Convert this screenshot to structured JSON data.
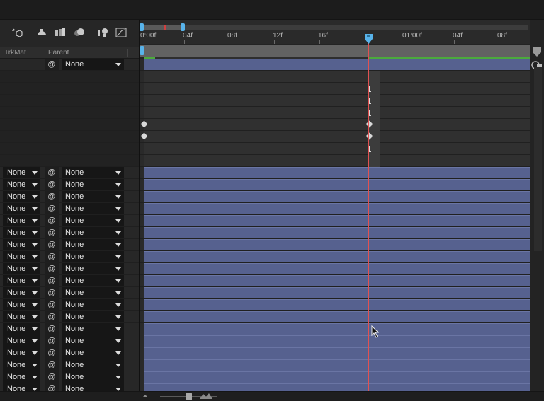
{
  "columns": {
    "trkmat": "TrkMat",
    "parent": "Parent"
  },
  "toolbar": {
    "icons": [
      "draft-3d-icon",
      "comp-flowchart-icon",
      "frame-blending-icon",
      "motion-blur-icon",
      "brainstorm-icon",
      "graph-editor-icon"
    ]
  },
  "top_layer": {
    "parent": "None"
  },
  "layers": [
    {
      "trkmat": "None",
      "parent": "None"
    },
    {
      "trkmat": "None",
      "parent": "None"
    },
    {
      "trkmat": "None",
      "parent": "None"
    },
    {
      "trkmat": "None",
      "parent": "None"
    },
    {
      "trkmat": "None",
      "parent": "None"
    },
    {
      "trkmat": "None",
      "parent": "None"
    },
    {
      "trkmat": "None",
      "parent": "None"
    },
    {
      "trkmat": "None",
      "parent": "None"
    },
    {
      "trkmat": "None",
      "parent": "None"
    },
    {
      "trkmat": "None",
      "parent": "None"
    },
    {
      "trkmat": "None",
      "parent": "None"
    },
    {
      "trkmat": "None",
      "parent": "None"
    },
    {
      "trkmat": "None",
      "parent": "None"
    },
    {
      "trkmat": "None",
      "parent": "None"
    },
    {
      "trkmat": "None",
      "parent": "None"
    },
    {
      "trkmat": "None",
      "parent": "None"
    },
    {
      "trkmat": "None",
      "parent": "None"
    },
    {
      "trkmat": "None",
      "parent": "None"
    },
    {
      "trkmat": "None",
      "parent": "None"
    }
  ],
  "ruler": {
    "ticks": [
      "0:00f",
      "04f",
      "08f",
      "12f",
      "16f",
      "01:00f",
      "04f",
      "08f"
    ]
  },
  "colors": {
    "layer_bar": "#56618f",
    "current_time_indicator": "#e15252",
    "work_area_marker": "#58b3ea",
    "render_bar": "#4caa3c"
  }
}
